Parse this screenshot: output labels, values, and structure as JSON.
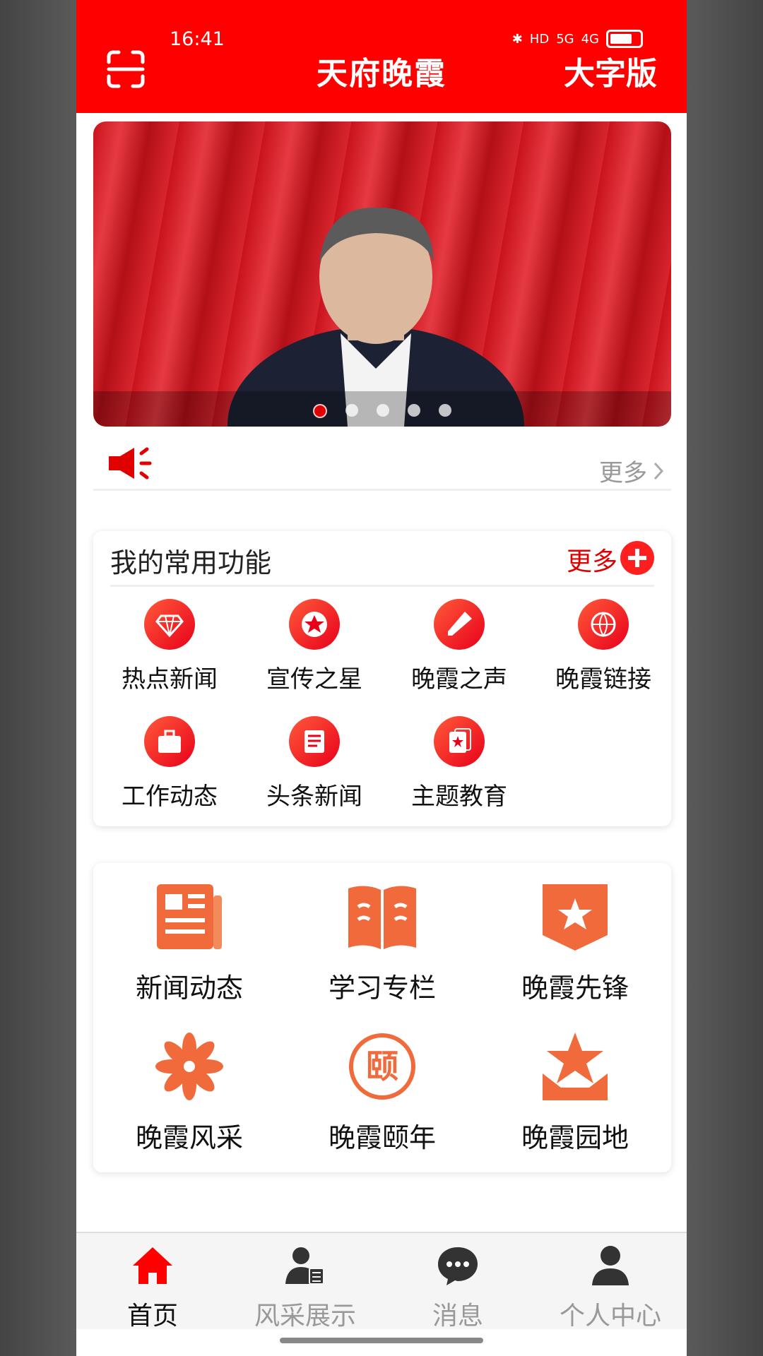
{
  "status": {
    "time": "16:41",
    "net1": "HD",
    "net2": "5G",
    "net3": "4G"
  },
  "header": {
    "title": "天府晚霞",
    "big_font": "大字版"
  },
  "banner": {
    "slides": 5,
    "active_index": 0
  },
  "notice": {
    "more": "更多"
  },
  "common": {
    "title": "我的常用功能",
    "more": "更多",
    "items": [
      {
        "label": "热点新闻",
        "icon": "diamond-icon"
      },
      {
        "label": "宣传之星",
        "icon": "star-icon"
      },
      {
        "label": "晚霞之声",
        "icon": "microphone-icon"
      },
      {
        "label": "晚霞链接",
        "icon": "globe-link-icon"
      },
      {
        "label": "工作动态",
        "icon": "briefcase-icon"
      },
      {
        "label": "头条新闻",
        "icon": "newspaper-icon"
      },
      {
        "label": "主题教育",
        "icon": "star-card-icon"
      }
    ]
  },
  "grid": {
    "items": [
      {
        "label": "新闻动态",
        "icon": "news-icon"
      },
      {
        "label": "学习专栏",
        "icon": "book-icon"
      },
      {
        "label": "晚霞先锋",
        "icon": "shield-star-icon"
      },
      {
        "label": "晚霞风采",
        "icon": "flower-icon"
      },
      {
        "label": "晚霞颐年",
        "icon": "yi-seal-icon",
        "seal_char": "颐"
      },
      {
        "label": "晚霞园地",
        "icon": "star-hands-icon"
      }
    ]
  },
  "nav": {
    "items": [
      {
        "label": "首页",
        "icon": "home-icon",
        "active": true
      },
      {
        "label": "风采展示",
        "icon": "user-card-icon",
        "active": false
      },
      {
        "label": "消息",
        "icon": "chat-icon",
        "active": false
      },
      {
        "label": "个人中心",
        "icon": "person-icon",
        "active": false
      }
    ]
  },
  "colors": {
    "brand_red": "#ff0000",
    "accent_orange": "#f06a3c",
    "muted": "#999999"
  }
}
